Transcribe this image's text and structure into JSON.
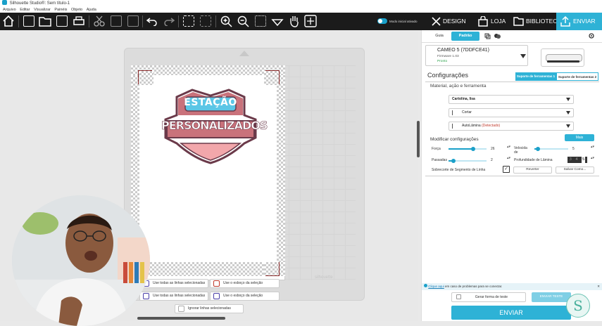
{
  "window": {
    "title": "Silhouette Studio®: Sem título-1"
  },
  "menu": [
    "Arquivo",
    "Editar",
    "Visualizar",
    "Painéis",
    "Objeto",
    "Ajuda"
  ],
  "toolbar": {
    "startup_mode_label": "Modo inicial ativado",
    "design_label": "DESIGN",
    "store_label": "LOJA",
    "library_label": "BIBLIOTECA",
    "send_label": "ENVIAR"
  },
  "canvas": {
    "logo_top": "ESTAÇÃO",
    "logo_main": "PERSONALIZADOS",
    "watermark": "silhouette",
    "options": {
      "use_all_lines_1": "Use todas as linhas selecionadas",
      "use_outline_1": "Use o esboço da seleção",
      "use_all_lines_2": "Use todas as linhas selecionadas",
      "use_outline_2": "Use o esboço da seleção",
      "ignore_lines": "Ignorar linhas selecionadas"
    }
  },
  "panel": {
    "tabs": {
      "guide": "Guia",
      "standard": "Padrão"
    },
    "device": {
      "name": "CAMEO 5 (7DDFCE41)",
      "firmware": "Firmware 1.03",
      "status": "Pronto"
    },
    "config_title": "Configurações",
    "support_tab_1": "Suporte de ferramentas 1",
    "support_tab_2": "Suporte de ferramentas 2",
    "material_heading": "Material, ação e ferramenta",
    "material_value": "Cartolina, lisa",
    "action_value": "Cortar",
    "tool_value": "AutoLâmina",
    "tool_detected": "(Detectado)",
    "modify_title": "Modificar configurações",
    "more_button": "Mais",
    "force_label": "Força",
    "force_value": "26",
    "speed_label_1": "Velocida",
    "speed_label_2": "de",
    "speed_value": "5",
    "passes_label": "Passadas",
    "passes_value": "2",
    "depth_label": "Profundidade de Lâmina",
    "depth_digits": [
      "3",
      "4",
      "5"
    ],
    "overcut_label": "Sobrecorte de Segmento de Linha",
    "revert_button": "Reverter",
    "save_as_button": "Salvar Como...",
    "info_link": "Clique aqui",
    "info_text": "em caso de problemas para se conectar.",
    "test_button": "Gerar forma de teste",
    "send_test_button": "ENVIAR TESTE",
    "send_button": "ENVIAR",
    "brand_letter": "S"
  },
  "colors": {
    "accent": "#2eb2d6",
    "toolbar_bg": "#1b1b1b",
    "logo_outline": "#6b3a4a",
    "logo_fill": "#c9727b",
    "logo_banner": "#5bc6e6"
  }
}
